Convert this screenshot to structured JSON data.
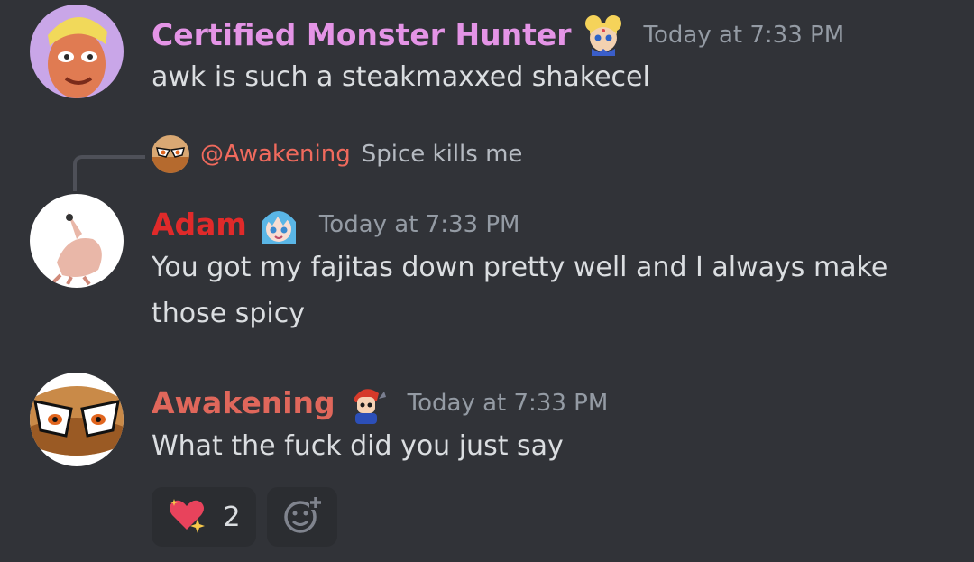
{
  "colors": {
    "background": "#313338",
    "text": "#dbdee1",
    "muted": "#949ba4",
    "reaction_bg": "#2b2d31"
  },
  "messages": [
    {
      "username": "Certified Monster Hunter",
      "username_color": "#e494e6",
      "badge_icon": "sailor-moon-emoji-icon",
      "timestamp": "Today at 7:33 PM",
      "lines": [
        "awk is such a steakmaxxed shakecel"
      ]
    },
    {
      "reply": {
        "mention": "@Awakening",
        "text": "Spice kills me"
      },
      "username": "Adam",
      "username_color": "#e02a2a",
      "badge_icon": "anime-girl-emoji-icon",
      "timestamp": "Today at 7:33 PM",
      "lines": [
        "You got my fajitas down pretty well and I always make",
        "those spicy"
      ]
    },
    {
      "username": "Awakening",
      "username_color": "#e0675b",
      "badge_icon": "pixel-character-emoji-icon",
      "timestamp": "Today at 7:33 PM",
      "lines": [
        "What the fuck did you just say"
      ],
      "reactions": [
        {
          "emoji": "sparkling-heart-icon",
          "count": "2"
        },
        {
          "emoji": "add-reaction-icon"
        }
      ]
    }
  ]
}
